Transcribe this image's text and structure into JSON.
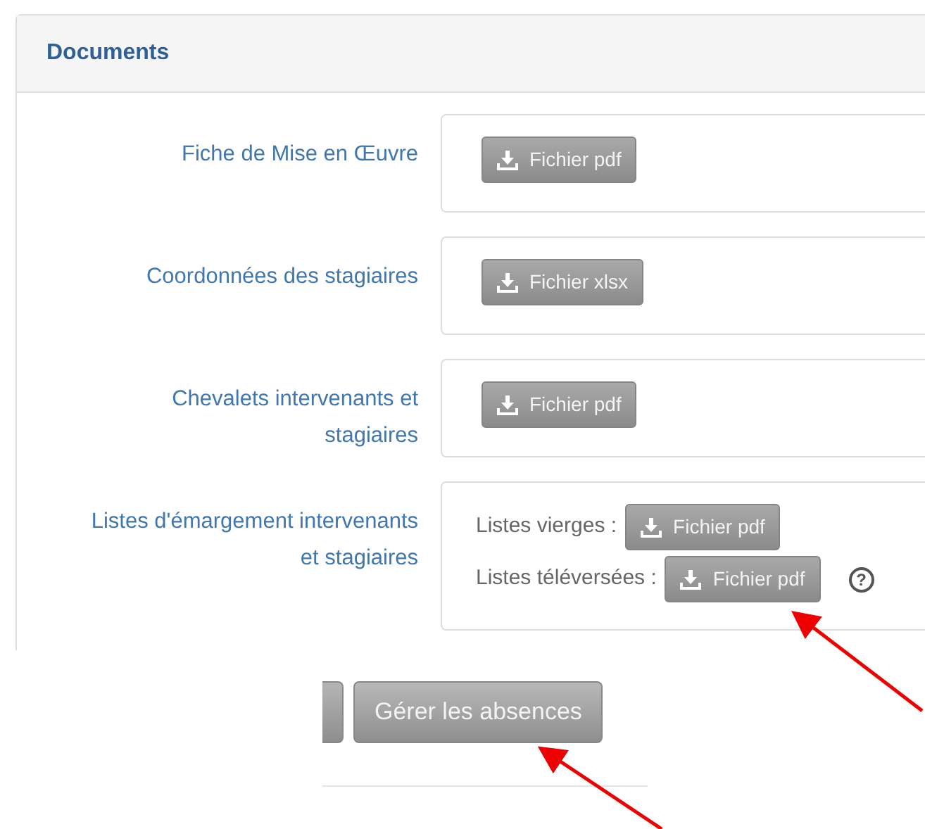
{
  "panel": {
    "title": "Documents"
  },
  "rows": [
    {
      "kind": "single",
      "label_lines": [
        "Fiche de Mise en Œuvre"
      ],
      "button": "Fichier pdf"
    },
    {
      "kind": "single",
      "label_lines": [
        "Coordonnées des stagiaires"
      ],
      "button": "Fichier xlsx"
    },
    {
      "kind": "single",
      "label_lines": [
        "Chevalets intervenants et",
        "stagiaires"
      ],
      "button": "Fichier pdf"
    },
    {
      "kind": "multi",
      "label_lines": [
        "Listes d'émargement intervenants",
        "et stagiaires"
      ],
      "lines": [
        {
          "label": "Listes vierges :",
          "button": "Fichier pdf"
        },
        {
          "label": "Listes téléversées :",
          "button": "Fichier pdf",
          "help": "?"
        }
      ]
    }
  ],
  "footer": {
    "button": "Gérer les absences"
  }
}
